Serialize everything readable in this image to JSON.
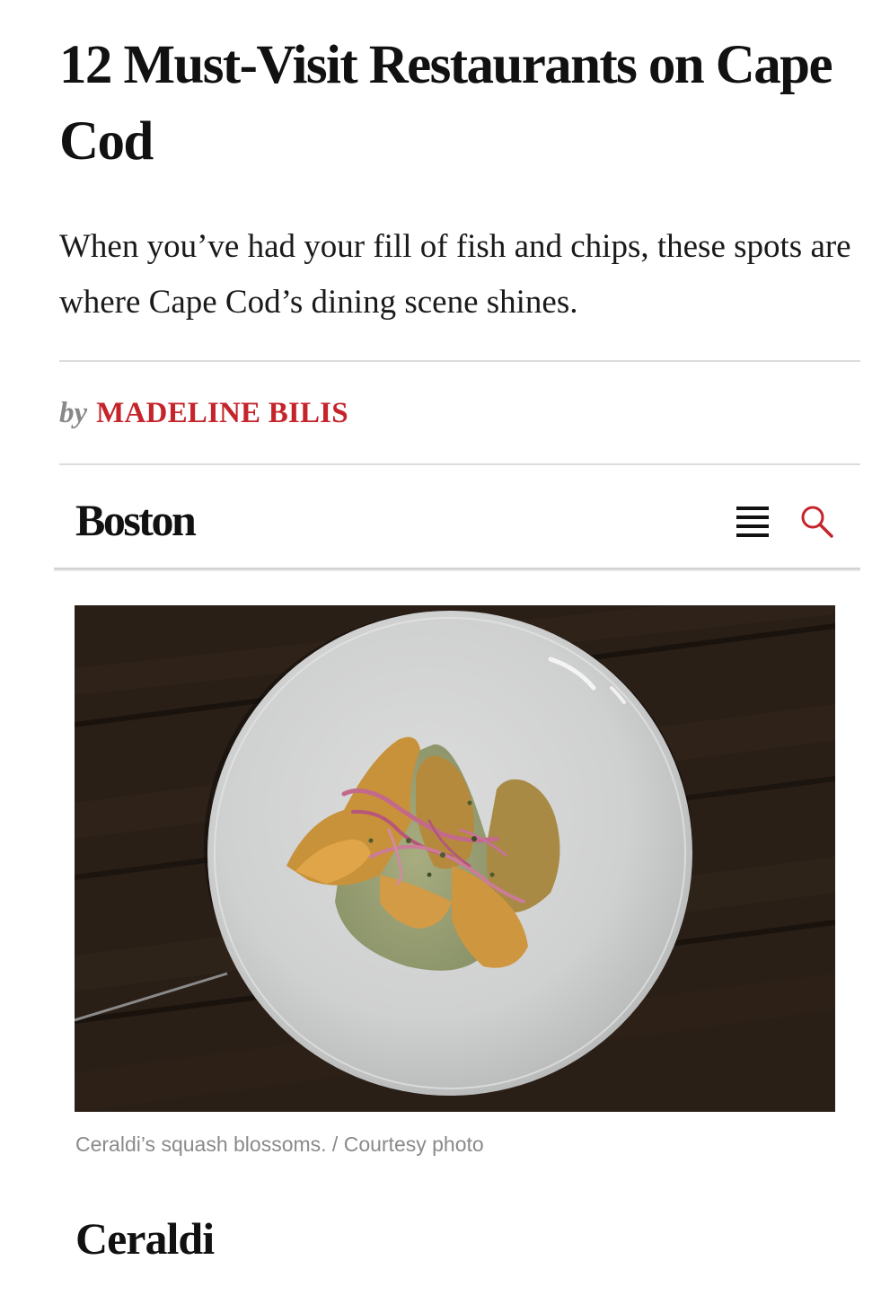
{
  "article": {
    "headline": "12 Must-Visit Restaurants on Cape Cod",
    "dek": "When you’ve had your fill of fish and chips, these spots are where Cape Cod’s dining scene shines.",
    "byline": {
      "prefix": "by",
      "author": "MADELINE BILIS"
    }
  },
  "masthead": {
    "logo": "Boston",
    "menu_icon": "hamburger-menu-icon",
    "search_icon": "search-icon"
  },
  "figure": {
    "caption": "Ceraldi’s squash blossoms. / Courtesy photo"
  },
  "section": {
    "title": "Ceraldi"
  },
  "colors": {
    "author_red": "#c5242b",
    "text": "#111111",
    "caption_gray": "#8a8a8a"
  }
}
